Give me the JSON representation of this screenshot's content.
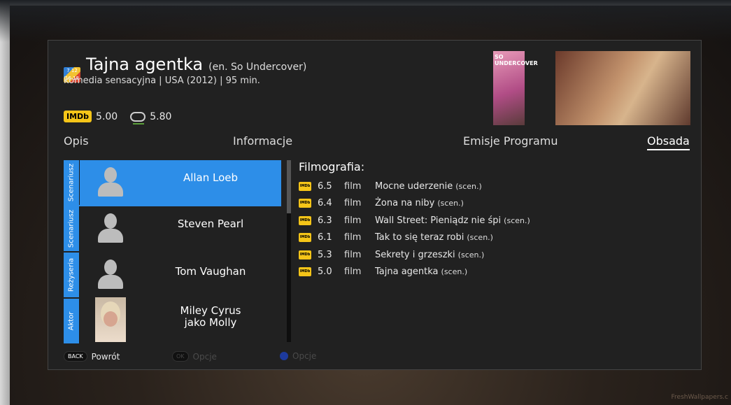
{
  "header": {
    "title": "Tajna agentka",
    "title_en": "(en. So Undercover)",
    "subtitle": "komedia sensacyjna | USA (2012) | 95 min.",
    "age_icon_text": "7 12 16 18"
  },
  "ratings": {
    "imdb_label": "IMDb",
    "imdb_score": "5.00",
    "filmweb_score": "5.80"
  },
  "poster": {
    "text": "SO UNDERCOVER"
  },
  "tabs": [
    {
      "label": "Opis"
    },
    {
      "label": "Informacje"
    },
    {
      "label": "Emisje Programu"
    },
    {
      "label": "Obsada"
    }
  ],
  "cast": [
    {
      "role": "Scenariusz",
      "name": "Allan Loeb",
      "extra": ""
    },
    {
      "role": "Scenariusz",
      "name": "Steven Pearl",
      "extra": ""
    },
    {
      "role": "Reżyseria",
      "name": "Tom Vaughan",
      "extra": ""
    },
    {
      "role": "Aktor",
      "name": "Miley Cyrus",
      "extra": "jako Molly"
    }
  ],
  "filmography": {
    "title": "Filmografia:",
    "badge": "IMDb",
    "items": [
      {
        "score": "6.5",
        "kind": "film",
        "title": "Mocne uderzenie",
        "note": "(scen.)"
      },
      {
        "score": "6.4",
        "kind": "film",
        "title": "Żona na niby",
        "note": "(scen.)"
      },
      {
        "score": "6.3",
        "kind": "film",
        "title": "Wall Street: Pieniądz nie śpi",
        "note": "(scen.)"
      },
      {
        "score": "6.1",
        "kind": "film",
        "title": "Tak to się teraz robi",
        "note": "(scen.)"
      },
      {
        "score": "5.3",
        "kind": "film",
        "title": "Sekrety i grzeszki",
        "note": "(scen.)"
      },
      {
        "score": "5.0",
        "kind": "film",
        "title": "Tajna agentka",
        "note": "(scen.)"
      }
    ]
  },
  "footer": {
    "back_key": "BACK",
    "back_label": "Powrót",
    "ok_key": "OK",
    "ok_label": "Opcje",
    "blue_label": "Opcje"
  },
  "watermark": "FreshWallpapers.c",
  "colors": {
    "accent": "#2d8ee8",
    "imdb": "#f5c518",
    "panel": "#212121"
  }
}
